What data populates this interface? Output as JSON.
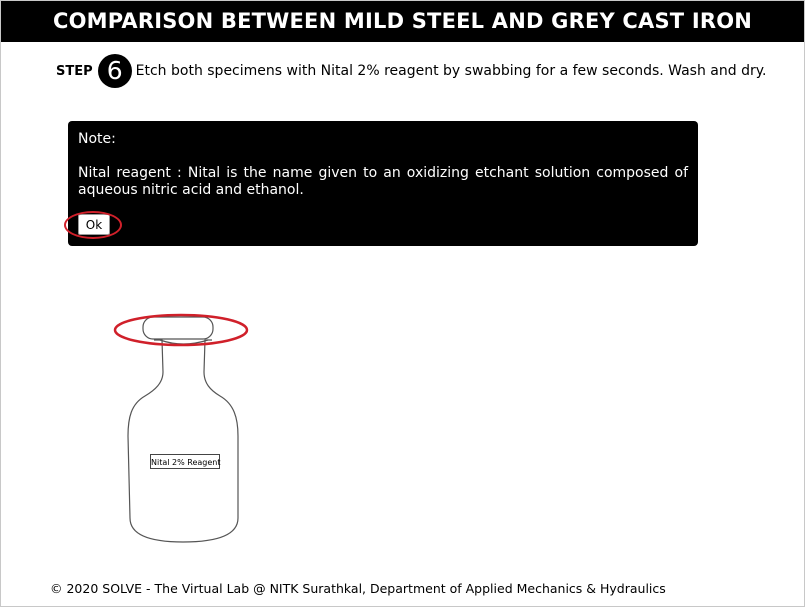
{
  "header": {
    "title": "COMPARISON BETWEEN MILD STEEL AND GREY CAST IRON"
  },
  "step": {
    "label": "STEP",
    "number": "6",
    "instruction": "Etch both specimens with Nital 2% reagent by swabbing for a few seconds. Wash and dry."
  },
  "note": {
    "title": "Note:",
    "body": "Nital reagent : Nital is the name given to an oxidizing etchant solution composed of aqueous nitric acid and ethanol.",
    "ok_label": "Ok"
  },
  "bottle": {
    "label": "Nital 2% Reagent"
  },
  "footer": {
    "text": "© 2020 SOLVE - The Virtual Lab @ NITK Surathkal, Department of Applied Mechanics & Hydraulics"
  },
  "colors": {
    "header_bg": "#000000",
    "highlight": "#d0202a",
    "note_bg": "#000000"
  }
}
